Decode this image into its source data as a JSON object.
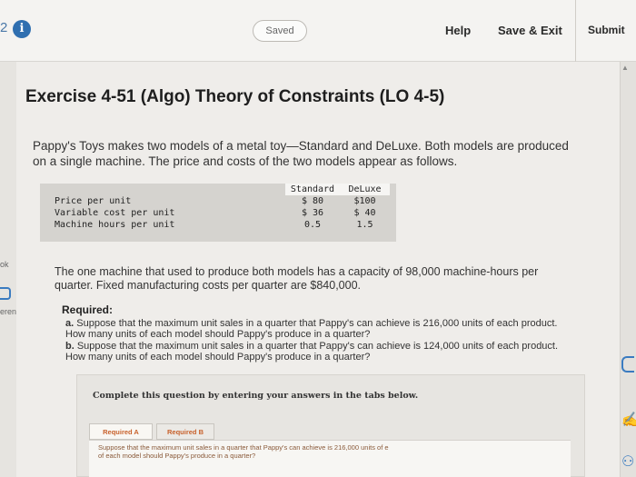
{
  "header": {
    "question_number": "2",
    "saved_label": "Saved",
    "help_label": "Help",
    "save_exit_label": "Save & Exit",
    "submit_label": "Submit"
  },
  "sidebar": {
    "label_ok": "ok",
    "label_references": "erences"
  },
  "exercise": {
    "title": "Exercise 4-51 (Algo) Theory of Constraints (LO 4-5)",
    "intro": "Pappy's Toys makes two models of a metal toy—Standard and DeLuxe. Both models are produced on a single machine. The price and costs of the two models appear as follows.",
    "table": {
      "columns": [
        "Standard",
        "DeLuxe"
      ],
      "rows": [
        {
          "label": "Price per unit",
          "standard": "$ 80",
          "deluxe": "$100"
        },
        {
          "label": "Variable cost per unit",
          "standard": "$ 36",
          "deluxe": "$ 40"
        },
        {
          "label": "Machine hours per unit",
          "standard": "0.5",
          "deluxe": "1.5"
        }
      ]
    },
    "capacity_text": "The one machine that used to produce both models has a capacity of 98,000 machine-hours per quarter. Fixed manufacturing costs per quarter are $840,000.",
    "required_title": "Required:",
    "required_a_marker": "a.",
    "required_a": "Suppose that the maximum unit sales in a quarter that Pappy's can achieve is 216,000 units of each product. How many units of each model should Pappy's produce in a quarter?",
    "required_b_marker": "b.",
    "required_b": "Suppose that the maximum unit sales in a quarter that Pappy's can achieve is 124,000 units of each product. How many units of each model should Pappy's produce in a quarter?"
  },
  "tabs_panel": {
    "instruction": "Complete this question by entering your answers in the tabs below.",
    "tabs": [
      {
        "label": "Required A"
      },
      {
        "label": "Required B"
      }
    ],
    "active_tab_text": "Suppose that the maximum unit sales in a quarter that Pappy's can achieve is 216,000 units of e",
    "active_tab_text_2": "of each model should Pappy's produce in a quarter?"
  },
  "colors": {
    "accent_blue": "#2f6fb0",
    "tab_text": "#c8612b"
  }
}
